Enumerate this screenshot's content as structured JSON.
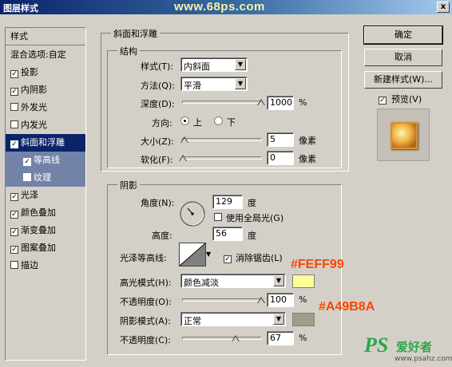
{
  "window": {
    "title": "图层样式",
    "watermark_top": "www.68ps.com",
    "close_label": "x"
  },
  "left_list": {
    "header": "样式",
    "blend_options": "混合选项:自定",
    "items": [
      {
        "label": "投影",
        "checked": true
      },
      {
        "label": "内阴影",
        "checked": true
      },
      {
        "label": "外发光",
        "checked": false
      },
      {
        "label": "内发光",
        "checked": false
      },
      {
        "label": "斜面和浮雕",
        "checked": true,
        "selected": true
      },
      {
        "label": "等高线",
        "checked": true,
        "sub": true
      },
      {
        "label": "纹理",
        "checked": false,
        "sub": true
      },
      {
        "label": "光泽",
        "checked": true
      },
      {
        "label": "颜色叠加",
        "checked": true
      },
      {
        "label": "渐变叠加",
        "checked": true
      },
      {
        "label": "图案叠加",
        "checked": true
      },
      {
        "label": "描边",
        "checked": false
      }
    ]
  },
  "bevel": {
    "group_title": "斜面和浮雕",
    "structure_title": "结构",
    "style_label": "样式(T):",
    "style_value": "内斜面",
    "method_label": "方法(Q):",
    "method_value": "平滑",
    "depth_label": "深度(D):",
    "depth_value": "1000",
    "depth_unit": "%",
    "depth_fraction": 1.0,
    "direction_label": "方向:",
    "direction_up": "上",
    "direction_down": "下",
    "size_label": "大小(Z):",
    "size_value": "5",
    "size_unit": "像素",
    "size_fraction": 0.02,
    "soften_label": "软化(F):",
    "soften_value": "0",
    "soften_unit": "像素",
    "soften_fraction": 0.0
  },
  "shading": {
    "group_title": "阴影",
    "angle_label": "角度(N):",
    "angle_value": "129",
    "angle_unit": "度",
    "global_light_label": "使用全局光(G)",
    "altitude_label": "高度:",
    "altitude_value": "56",
    "altitude_unit": "度",
    "gloss_contour_label": "光泽等高线:",
    "anti_alias_label": "消除锯齿(L)",
    "highlight_mode_label": "高光模式(H):",
    "highlight_mode_value": "颜色减淡",
    "highlight_color": "#FEFF99",
    "highlight_opacity_label": "不透明度(O):",
    "highlight_opacity_value": "100",
    "highlight_opacity_fraction": 1.0,
    "shadow_mode_label": "阴影模式(A):",
    "shadow_mode_value": "正常",
    "shadow_color": "#A49B8A",
    "shadow_opacity_label": "不透明度(C):",
    "shadow_opacity_value": "67",
    "shadow_opacity_fraction": 0.67,
    "percent": "%"
  },
  "annotations": {
    "highlight_hex": "#FEFF99",
    "shadow_hex": "#A49B8A"
  },
  "buttons": {
    "ok": "确定",
    "cancel": "取消",
    "new_style": "新建样式(W)...",
    "preview": "预览(V)"
  },
  "watermark_bottom": {
    "logo": "PS",
    "brand": "爱好者",
    "url": "www.psahz.com"
  }
}
